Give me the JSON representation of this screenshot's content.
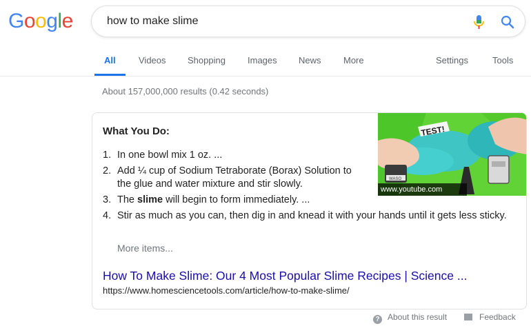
{
  "logo": {
    "letters": [
      "G",
      "o",
      "o",
      "g",
      "l",
      "e"
    ],
    "colors": [
      "#4285f4",
      "#ea4335",
      "#fbbc05",
      "#4285f4",
      "#34a853",
      "#ea4335"
    ]
  },
  "search": {
    "query": "how to make slime",
    "mic_icon": "microphone-icon",
    "search_icon": "magnifier-icon"
  },
  "tabs": {
    "all": "All",
    "videos": "Videos",
    "shopping": "Shopping",
    "images": "Images",
    "news": "News",
    "more": "More",
    "settings": "Settings",
    "tools": "Tools"
  },
  "stats": "About 157,000,000 results (0.42 seconds)",
  "snippet": {
    "heading": "What You Do:",
    "steps": [
      {
        "num": "1.",
        "text": "In one bowl mix 1 oz. ..."
      },
      {
        "num": "2.",
        "text": "Add ¼ cup of Sodium Tetraborate (Borax) Solution to the glue and water mixture and stir slowly."
      },
      {
        "num": "3.",
        "pre": "The ",
        "bold": "slime",
        "post": " will begin to form immediately. ..."
      },
      {
        "num": "4.",
        "text": "Stir as much as you can, then dig in and knead it with your hands until it gets less sticky."
      }
    ],
    "more_items": "More items...",
    "result_title": "How To Make Slime: Our 4 Most Popular Slime Recipes | Science ...",
    "result_url": "https://www.homesciencetools.com/article/how-to-make-slime/",
    "thumbnail": {
      "caption": "www.youtube.com",
      "badge_text": "TEST!",
      "jar_label": "WASO"
    }
  },
  "footer": {
    "about": "About this result",
    "feedback": "Feedback"
  },
  "colors": {
    "accent": "#1a73e8",
    "link": "#1a0dab",
    "muted": "#70757a"
  }
}
